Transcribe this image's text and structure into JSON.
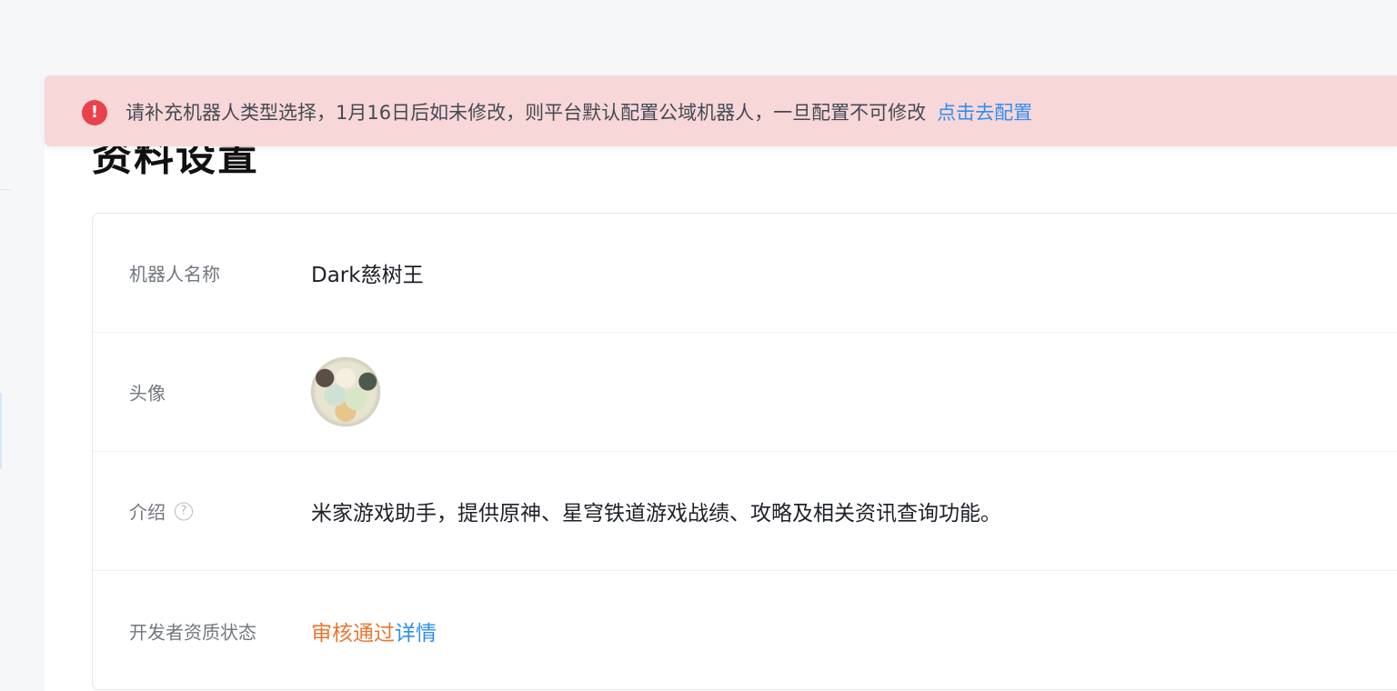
{
  "page": {
    "title": "资料设置"
  },
  "alert": {
    "icon": "exclamation-circle-icon",
    "message": "请补充机器人类型选择，1月16日后如未修改，则平台默认配置公域机器人，一旦配置不可修改",
    "link_label": "点击去配置",
    "colors": {
      "background": "#f8d7d9",
      "icon": "#e9424c",
      "link": "#2f8ef0"
    }
  },
  "profile": {
    "rows": [
      {
        "label": "机器人名称",
        "value": "Dark慈树王"
      },
      {
        "label": "头像",
        "value": ""
      },
      {
        "label": "介绍",
        "value": "米家游戏助手，提供原神、星穹铁道游戏战绩、攻略及相关资讯查询功能。",
        "help_icon": "question-circle-icon"
      },
      {
        "label": "开发者资质状态",
        "status": "审核通过",
        "detail_link": "详情"
      }
    ],
    "colors": {
      "status_approved": "#e9772f",
      "link": "#2f8ef0"
    }
  }
}
